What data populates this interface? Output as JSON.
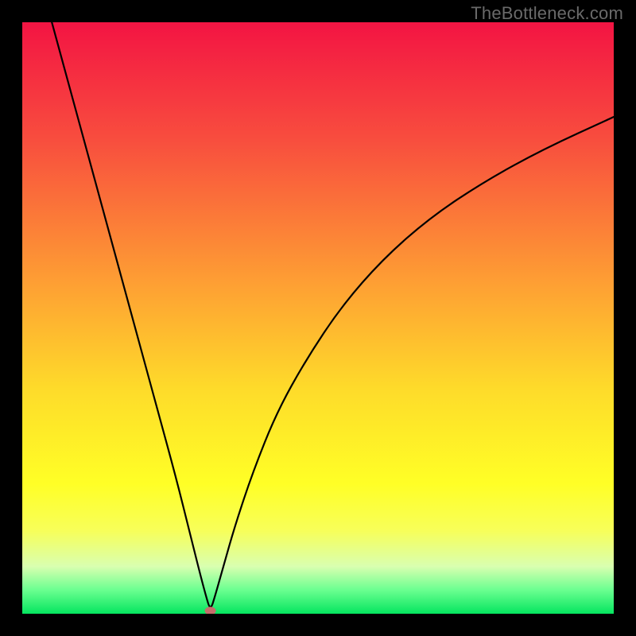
{
  "watermark": "TheBottleneck.com",
  "chart_data": {
    "type": "line",
    "title": "",
    "xlabel": "",
    "ylabel": "",
    "xlim": [
      0,
      100
    ],
    "ylim": [
      0,
      100
    ],
    "notes": "Bottleneck/dip curve on a vertical red→orange→yellow→green gradient background. Curve is black; a small red marker sits at the minimum (≈x=32). No axis ticks or labels shown.",
    "background_gradient_stops": [
      {
        "pct": 0,
        "color": "#f31443"
      },
      {
        "pct": 20,
        "color": "#f84e3e"
      },
      {
        "pct": 45,
        "color": "#fea233"
      },
      {
        "pct": 62,
        "color": "#fedb2a"
      },
      {
        "pct": 78,
        "color": "#ffff26"
      },
      {
        "pct": 86,
        "color": "#f7ff5a"
      },
      {
        "pct": 92,
        "color": "#d9ffb0"
      },
      {
        "pct": 96,
        "color": "#6aff90"
      },
      {
        "pct": 100,
        "color": "#05e55f"
      }
    ],
    "min_marker": {
      "x": 31.8,
      "y": 0.5,
      "color": "#c56d6b"
    },
    "series": [
      {
        "name": "curve",
        "x": [
          5,
          8,
          11,
          14,
          17,
          20,
          23,
          26,
          28.5,
          30.0,
          31.0,
          31.8,
          32.6,
          34.0,
          36.0,
          39.0,
          43.0,
          48.0,
          54.0,
          61.0,
          69.0,
          78.0,
          88.0,
          100.0
        ],
        "y": [
          100,
          89,
          78,
          67,
          56,
          45,
          34,
          23,
          13,
          7.0,
          3.2,
          0.5,
          3.0,
          8.0,
          15.0,
          24.0,
          34.0,
          43.0,
          52.0,
          60.0,
          67.0,
          73.0,
          78.5,
          84.0
        ]
      }
    ]
  }
}
